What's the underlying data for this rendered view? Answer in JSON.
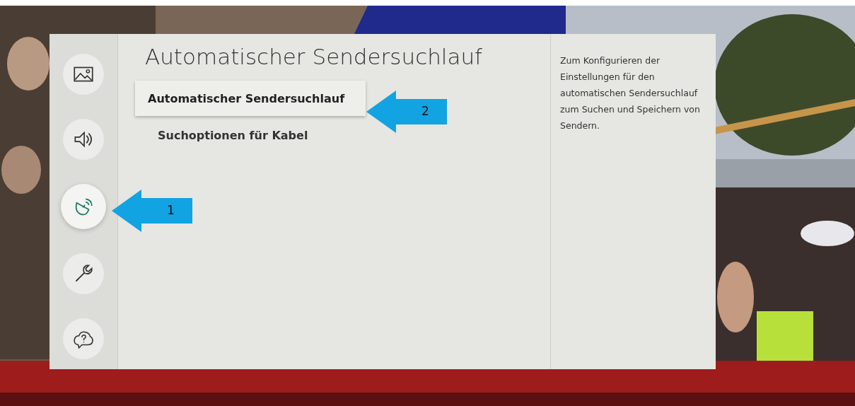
{
  "sidebar": {
    "items": [
      {
        "kind": "picture",
        "selected": false
      },
      {
        "kind": "sound",
        "selected": false
      },
      {
        "kind": "broadcast",
        "selected": true
      },
      {
        "kind": "tools",
        "selected": false
      },
      {
        "kind": "support",
        "selected": false
      }
    ]
  },
  "menu": {
    "title": "Automatischer Sendersuchlauf",
    "items": [
      {
        "label": "Automatischer Sendersuchlauf",
        "selected": true
      },
      {
        "label": "Suchoptionen für Kabel",
        "selected": false
      }
    ]
  },
  "description": "Zum Konfigurieren der Einstellungen für den automatischen Sendersuchlauf zum Suchen und Speichern von Sendern.",
  "annotations": [
    {
      "number": "1"
    },
    {
      "number": "2"
    }
  ]
}
